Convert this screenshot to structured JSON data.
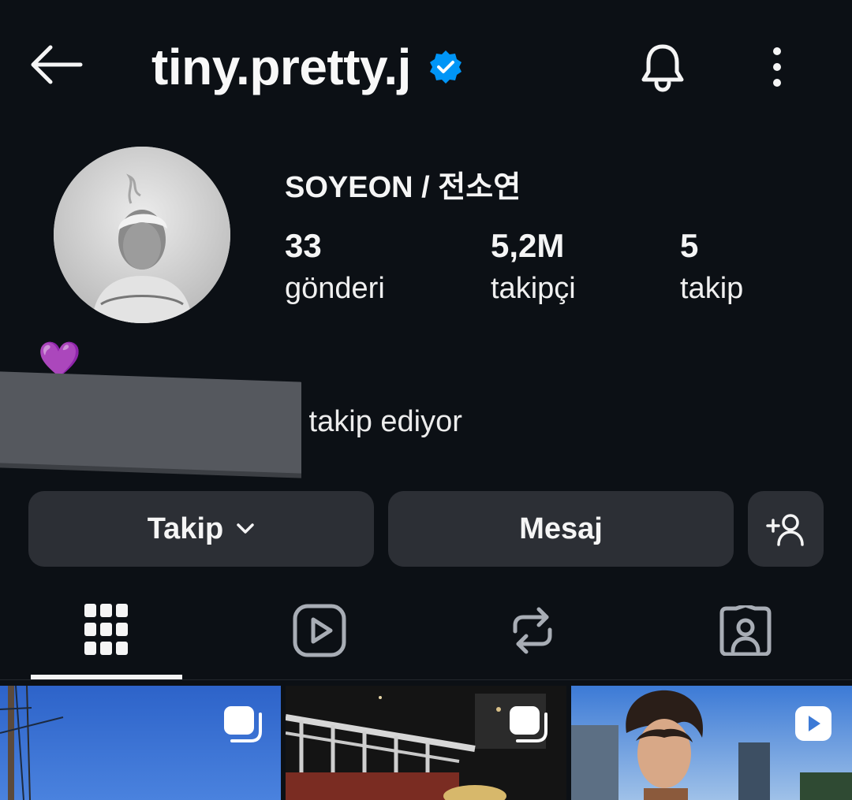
{
  "header": {
    "username": "tiny.pretty.j",
    "back_icon": "back-arrow-icon",
    "verified_icon": "verified-badge-icon",
    "bell_icon": "bell-icon",
    "more_icon": "more-vertical-icon"
  },
  "profile": {
    "display_name": "SOYEON / 전소연",
    "stats": [
      {
        "value": "33",
        "label": "gönderi"
      },
      {
        "value": "5,2M",
        "label": "takipçi"
      },
      {
        "value": "5",
        "label": "takip"
      }
    ],
    "bio_emoji": "💜",
    "followed_by_text": "ıl takip ediyor"
  },
  "actions": {
    "follow_label": "Takip",
    "message_label": "Mesaj",
    "add_person_icon": "add-person-icon"
  },
  "tabs": [
    {
      "name": "posts",
      "icon": "grid-icon",
      "active": true
    },
    {
      "name": "reels",
      "icon": "reels-icon",
      "active": false
    },
    {
      "name": "reposts",
      "icon": "repost-icon",
      "active": false
    },
    {
      "name": "tagged",
      "icon": "tagged-person-icon",
      "active": false
    }
  ],
  "colors": {
    "background": "#0c1015",
    "button": "#2c2f35",
    "verified": "#0095f6",
    "text": "#f5f5f5"
  }
}
